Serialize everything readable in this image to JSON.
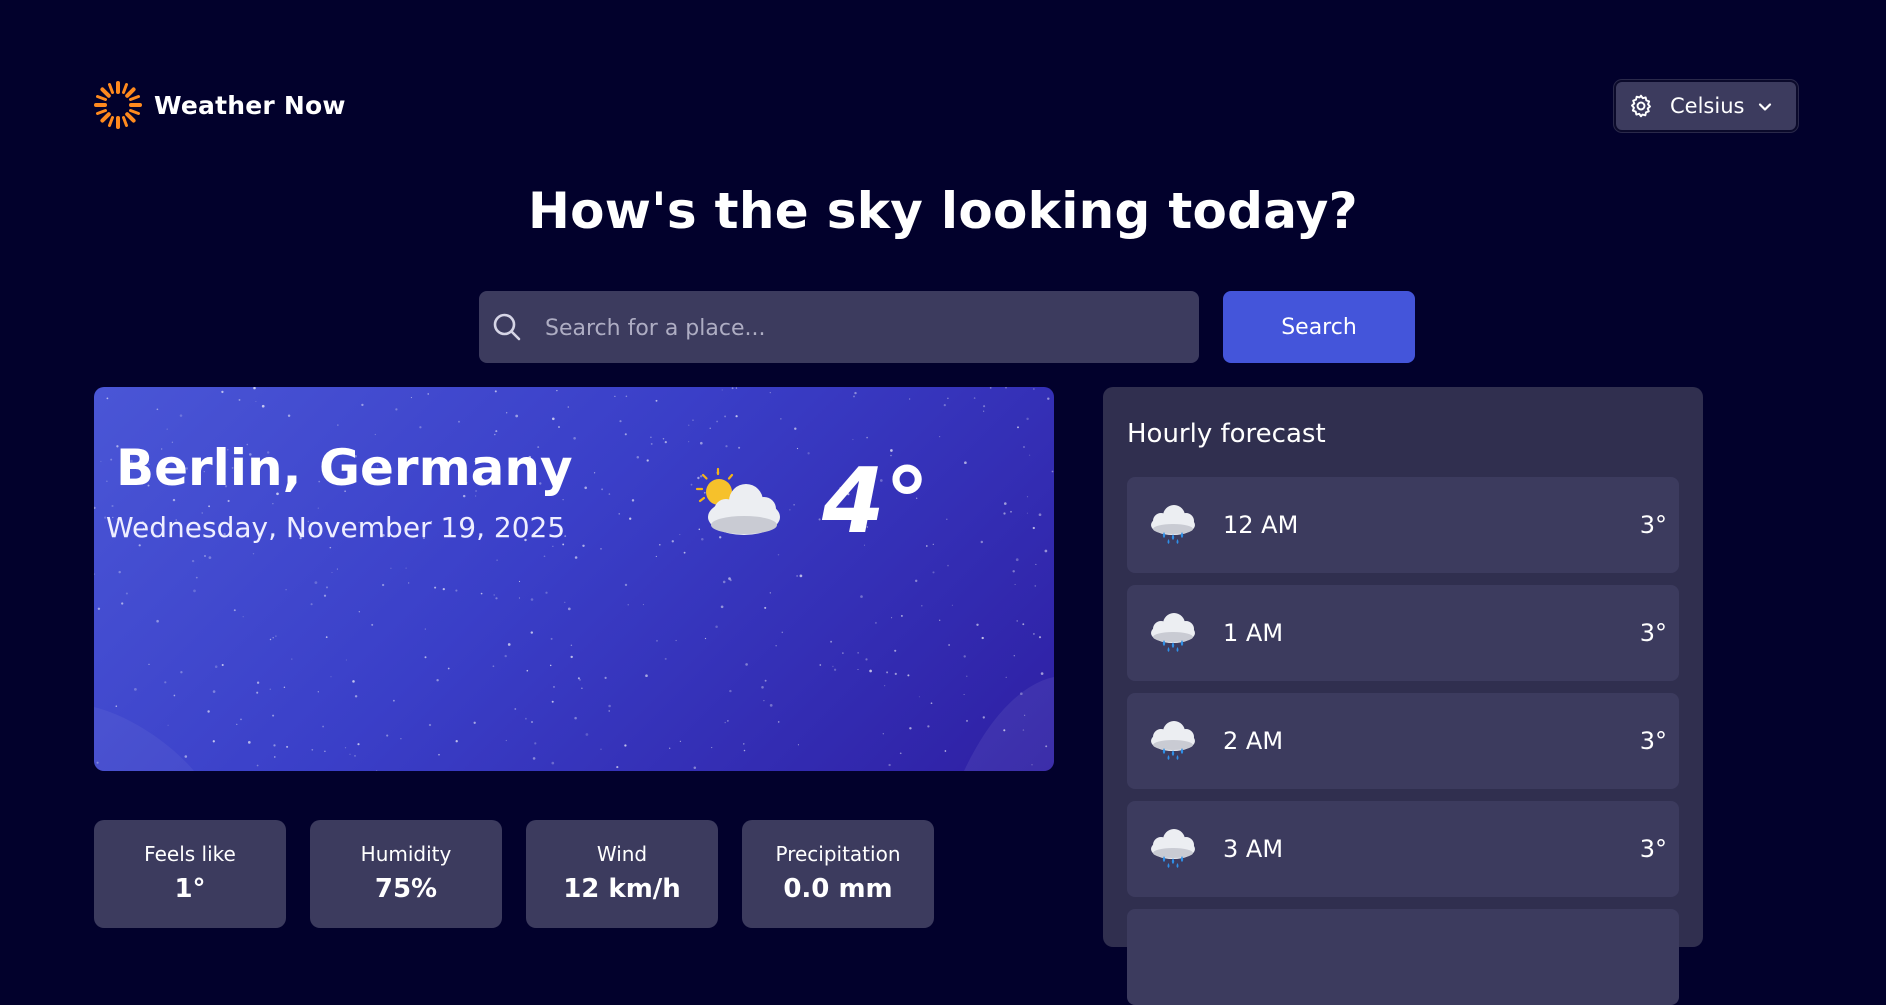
{
  "app": {
    "name": "Weather Now",
    "unit_label": "Celsius"
  },
  "headline": "How's the sky looking today?",
  "search": {
    "placeholder": "Search for a place...",
    "button_label": "Search"
  },
  "current": {
    "location": "Berlin, Germany",
    "date": "Wednesday, November 19, 2025",
    "temperature": "4°",
    "icon": "partly-cloudy-icon"
  },
  "stats": [
    {
      "label": "Feels like",
      "value": "1°"
    },
    {
      "label": "Humidity",
      "value": "75%"
    },
    {
      "label": "Wind",
      "value": "12 km/h"
    },
    {
      "label": "Precipitation",
      "value": "0.0 mm"
    }
  ],
  "hourly": {
    "title": "Hourly forecast",
    "items": [
      {
        "time": "12 AM",
        "temp": "3°",
        "icon": "rain-cloud-icon"
      },
      {
        "time": "1 AM",
        "temp": "3°",
        "icon": "rain-cloud-icon"
      },
      {
        "time": "2 AM",
        "temp": "3°",
        "icon": "rain-cloud-icon"
      },
      {
        "time": "3 AM",
        "temp": "3°",
        "icon": "rain-cloud-icon"
      }
    ]
  },
  "colors": {
    "background": "#02012c",
    "panel": "#3c3b5e",
    "panel_dark": "#302f4f",
    "accent": "#4455da",
    "logo_orange": "#ff8a1e"
  }
}
